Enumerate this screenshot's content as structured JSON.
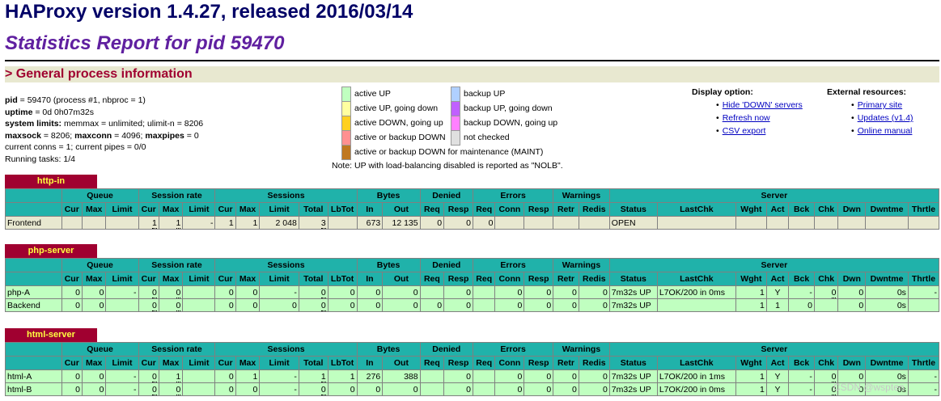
{
  "header": {
    "title": "HAProxy version 1.4.27, released 2016/03/14",
    "subtitle": "Statistics Report for pid 59470",
    "section": "> General process information"
  },
  "process_info": [
    {
      "k": "pid",
      "v": " = 59470 (process #1, nbproc = 1)"
    },
    {
      "k": "uptime",
      "v": " = 0d 0h07m32s"
    },
    {
      "k": "system limits:",
      "v": " memmax = unlimited; ulimit-n = 8206"
    },
    {
      "k": "maxsock",
      "v": " = 8206; ",
      "k2": "maxconn",
      "v2": " = 4096; ",
      "k3": "maxpipes",
      "v3": " = 0"
    },
    {
      "k": "",
      "v": "current conns = 1; current pipes = 0/0"
    },
    {
      "k": "",
      "v": "Running tasks: 1/4"
    }
  ],
  "legend": {
    "items": [
      {
        "label": "active UP",
        "color": "#c0ffc0"
      },
      {
        "label": "backup UP",
        "color": "#b0d0ff"
      },
      {
        "label": "active UP, going down",
        "color": "#ffffa0"
      },
      {
        "label": "backup UP, going down",
        "color": "#c060ff"
      },
      {
        "label": "active DOWN, going up",
        "color": "#ffd020"
      },
      {
        "label": "backup DOWN, going up",
        "color": "#ff80ff"
      },
      {
        "label": "active or backup DOWN",
        "color": "#ff9090"
      },
      {
        "label": "not checked",
        "color": "#e0e0e0"
      },
      {
        "label": "active or backup DOWN for maintenance (MAINT)",
        "color": "#c07820"
      }
    ],
    "note": "Note: UP with load-balancing disabled is reported as \"NOLB\"."
  },
  "display_options": {
    "title": "Display option:",
    "links": [
      "Hide 'DOWN' servers",
      "Refresh now",
      "CSV export"
    ]
  },
  "external_resources": {
    "title": "External resources:",
    "links": [
      "Primary site",
      "Updates (v1.4)",
      "Online manual"
    ]
  },
  "colors": {
    "header_bg": "#20b2aa",
    "proxy_name_bg": "#a00030",
    "frontend_row": "#e8e8d0",
    "up_row": "#c0ffc0"
  },
  "proxies": [
    {
      "name": "http-in",
      "groups": [
        "",
        "Queue",
        "Session rate",
        "Sessions",
        "Bytes",
        "Denied",
        "Errors",
        "Warnings",
        "Server"
      ],
      "cols": [
        "",
        "Cur",
        "Max",
        "Limit",
        "Cur",
        "Max",
        "Limit",
        "Cur",
        "Max",
        "Limit",
        "Total",
        "LbTot",
        "In",
        "Out",
        "Req",
        "Resp",
        "Req",
        "Conn",
        "Resp",
        "Retr",
        "Redis",
        "Status",
        "LastChk",
        "Wght",
        "Act",
        "Bck",
        "Chk",
        "Dwn",
        "Dwntme",
        "Thrtle"
      ],
      "rows": [
        {
          "kind": "frontend",
          "cells": [
            "Frontend",
            "",
            "",
            "",
            "1",
            "1",
            "-",
            "1",
            "1",
            "2 048",
            "3",
            "",
            "673",
            "12 135",
            "0",
            "0",
            "0",
            "",
            "",
            "",
            "",
            "OPEN",
            "",
            "",
            "",
            "",
            "",
            "",
            "",
            ""
          ]
        }
      ]
    },
    {
      "name": "php-server",
      "groups": [
        "",
        "Queue",
        "Session rate",
        "Sessions",
        "Bytes",
        "Denied",
        "Errors",
        "Warnings",
        "Server"
      ],
      "cols": [
        "",
        "Cur",
        "Max",
        "Limit",
        "Cur",
        "Max",
        "Limit",
        "Cur",
        "Max",
        "Limit",
        "Total",
        "LbTot",
        "In",
        "Out",
        "Req",
        "Resp",
        "Req",
        "Conn",
        "Resp",
        "Retr",
        "Redis",
        "Status",
        "LastChk",
        "Wght",
        "Act",
        "Bck",
        "Chk",
        "Dwn",
        "Dwntme",
        "Thrtle"
      ],
      "rows": [
        {
          "kind": "up",
          "cells": [
            "php-A",
            "0",
            "0",
            "-",
            "0",
            "0",
            "",
            "0",
            "0",
            "-",
            "0",
            "0",
            "0",
            "0",
            "",
            "0",
            "",
            "0",
            "0",
            "0",
            "0",
            "7m32s UP",
            "L7OK/200 in 0ms",
            "1",
            "Y",
            "-",
            "0",
            "0",
            "0s",
            "-"
          ]
        },
        {
          "kind": "up",
          "cells": [
            "Backend",
            "0",
            "0",
            "",
            "0",
            "0",
            "",
            "0",
            "0",
            "0",
            "0",
            "0",
            "0",
            "0",
            "0",
            "0",
            "",
            "0",
            "0",
            "0",
            "0",
            "7m32s UP",
            "",
            "1",
            "1",
            "0",
            "",
            "0",
            "0s",
            ""
          ]
        }
      ]
    },
    {
      "name": "html-server",
      "groups": [
        "",
        "Queue",
        "Session rate",
        "Sessions",
        "Bytes",
        "Denied",
        "Errors",
        "Warnings",
        "Server"
      ],
      "cols": [
        "",
        "Cur",
        "Max",
        "Limit",
        "Cur",
        "Max",
        "Limit",
        "Cur",
        "Max",
        "Limit",
        "Total",
        "LbTot",
        "In",
        "Out",
        "Req",
        "Resp",
        "Req",
        "Conn",
        "Resp",
        "Retr",
        "Redis",
        "Status",
        "LastChk",
        "Wght",
        "Act",
        "Bck",
        "Chk",
        "Dwn",
        "Dwntme",
        "Thrtle"
      ],
      "rows": [
        {
          "kind": "up",
          "cells": [
            "html-A",
            "0",
            "0",
            "-",
            "0",
            "1",
            "",
            "0",
            "1",
            "-",
            "1",
            "1",
            "276",
            "388",
            "",
            "0",
            "",
            "0",
            "0",
            "0",
            "0",
            "7m32s UP",
            "L7OK/200 in 1ms",
            "1",
            "Y",
            "-",
            "0",
            "0",
            "0s",
            "-"
          ]
        },
        {
          "kind": "up",
          "cells": [
            "html-B",
            "0",
            "0",
            "-",
            "0",
            "0",
            "",
            "0",
            "0",
            "-",
            "0",
            "0",
            "0",
            "0",
            "",
            "0",
            "",
            "0",
            "0",
            "0",
            "0",
            "7m32s UP",
            "L7OK/200 in 0ms",
            "1",
            "Y",
            "-",
            "0",
            "0",
            "0s",
            "-"
          ]
        }
      ]
    }
  ],
  "watermark": "CSDN @wspten"
}
